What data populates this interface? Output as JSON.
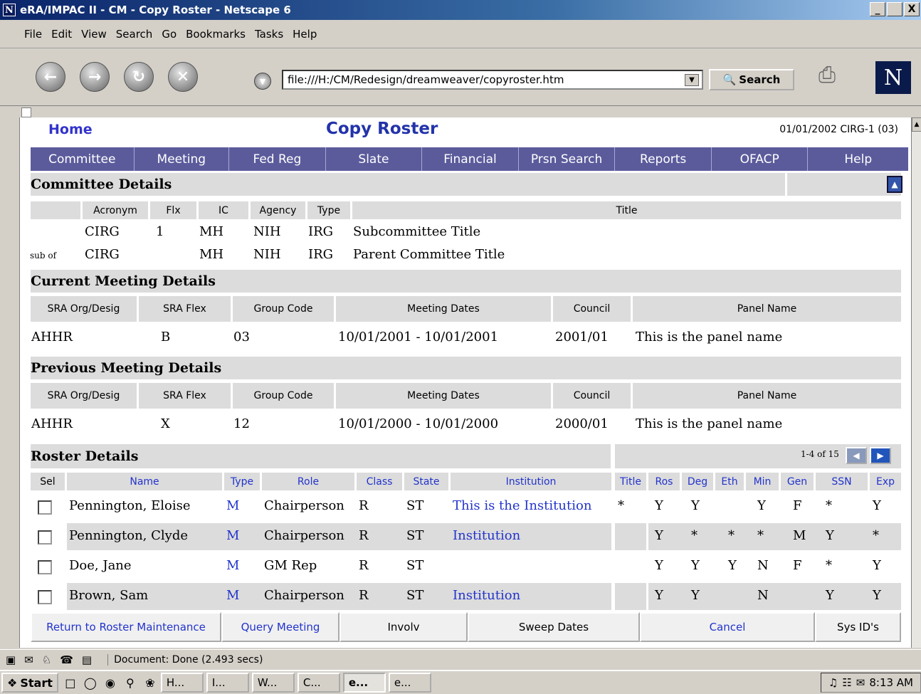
{
  "window": {
    "title": "eRA/IMPAC II - CM - Copy Roster - Netscape 6",
    "logo_letter": "N",
    "minimize": "_",
    "maximize": " ",
    "close": "X"
  },
  "menu": [
    "File",
    "Edit",
    "View",
    "Search",
    "Go",
    "Bookmarks",
    "Tasks",
    "Help"
  ],
  "toolbar": {
    "url": "file:///H:/CM/Redesign/dreamweaver/copyroster.htm",
    "search_label": "Search",
    "brand_letter": "N"
  },
  "page": {
    "home": "Home",
    "title": "Copy Roster",
    "date_info": "01/01/2002 CIRG-1 (03)",
    "tabs": [
      "Committee",
      "Meeting",
      "Fed Reg",
      "Slate",
      "Financial",
      "Prsn Search",
      "Reports",
      "OFACP",
      "Help"
    ]
  },
  "committee": {
    "heading": "Committee Details",
    "headers": [
      "Acronym",
      "Flx",
      "IC",
      "Agency",
      "Type",
      "Title"
    ],
    "rows": [
      {
        "prefix": "",
        "acronym": "CIRG",
        "flx": "1",
        "ic": "MH",
        "agency": "NIH",
        "type": "IRG",
        "title": "Subcommittee Title"
      },
      {
        "prefix": "sub of",
        "acronym": "CIRG",
        "flx": "",
        "ic": "MH",
        "agency": "NIH",
        "type": "IRG",
        "title": "Parent Committee Title"
      }
    ]
  },
  "current_meeting": {
    "heading": "Current Meeting Details",
    "headers": [
      "SRA Org/Desig",
      "SRA Flex",
      "Group Code",
      "Meeting Dates",
      "Council",
      "Panel Name"
    ],
    "row": {
      "org": "AHHR",
      "flex": "B",
      "group": "03",
      "dates": "10/01/2001 - 10/01/2001",
      "council": "2001/01",
      "panel": "This is the panel name"
    }
  },
  "previous_meeting": {
    "heading": "Previous Meeting Details",
    "headers": [
      "SRA Org/Desig",
      "SRA Flex",
      "Group Code",
      "Meeting Dates",
      "Council",
      "Panel Name"
    ],
    "row": {
      "org": "AHHR",
      "flex": "X",
      "group": "12",
      "dates": "10/01/2000 - 10/01/2000",
      "council": "2000/01",
      "panel": "This is the panel name"
    }
  },
  "roster": {
    "heading": "Roster Details",
    "pager": "1-4 of 15",
    "headers": [
      "Sel",
      "Name",
      "Type",
      "Role",
      "Class",
      "State",
      "Institution",
      "Title",
      "Ros",
      "Deg",
      "Eth",
      "Min",
      "Gen",
      "SSN",
      "Exp"
    ],
    "rows": [
      {
        "name": "Pennington, Eloise",
        "type": "M",
        "role": "Chairperson",
        "class": "R",
        "state": "ST",
        "institution": "This is the Institution",
        "title": "*",
        "ros": "Y",
        "deg": "Y",
        "eth": "",
        "min": "Y",
        "gen": "F",
        "ssn": "*",
        "exp": "Y"
      },
      {
        "name": "Pennington, Clyde",
        "type": "M",
        "role": "Chairperson",
        "class": "R",
        "state": "ST",
        "institution": "Institution",
        "title": "",
        "ros": "Y",
        "deg": "*",
        "eth": "*",
        "min": "*",
        "gen": "M",
        "ssn": "Y",
        "exp": "*"
      },
      {
        "name": "Doe, Jane",
        "type": "M",
        "role": "GM Rep",
        "class": "R",
        "state": "ST",
        "institution": "",
        "title": "",
        "ros": "Y",
        "deg": "Y",
        "eth": "Y",
        "min": "N",
        "gen": "F",
        "ssn": "*",
        "exp": "Y"
      },
      {
        "name": "Brown, Sam",
        "type": "M",
        "role": "Chairperson",
        "class": "R",
        "state": "ST",
        "institution": "Institution",
        "title": "",
        "ros": "Y",
        "deg": "Y",
        "eth": "",
        "min": "N",
        "gen": "",
        "ssn": "Y",
        "exp": "Y"
      }
    ]
  },
  "buttons": [
    "Return to Roster Maintenance",
    "Query Meeting",
    "Involv",
    "Sweep Dates",
    "Cancel",
    "Sys ID's"
  ],
  "status": {
    "text": "Document: Done (2.493 secs)"
  },
  "taskbar": {
    "start": "Start",
    "items": [
      "H...",
      "I...",
      "W...",
      "C...",
      "e...",
      "e..."
    ],
    "clock": "8:13 AM"
  }
}
